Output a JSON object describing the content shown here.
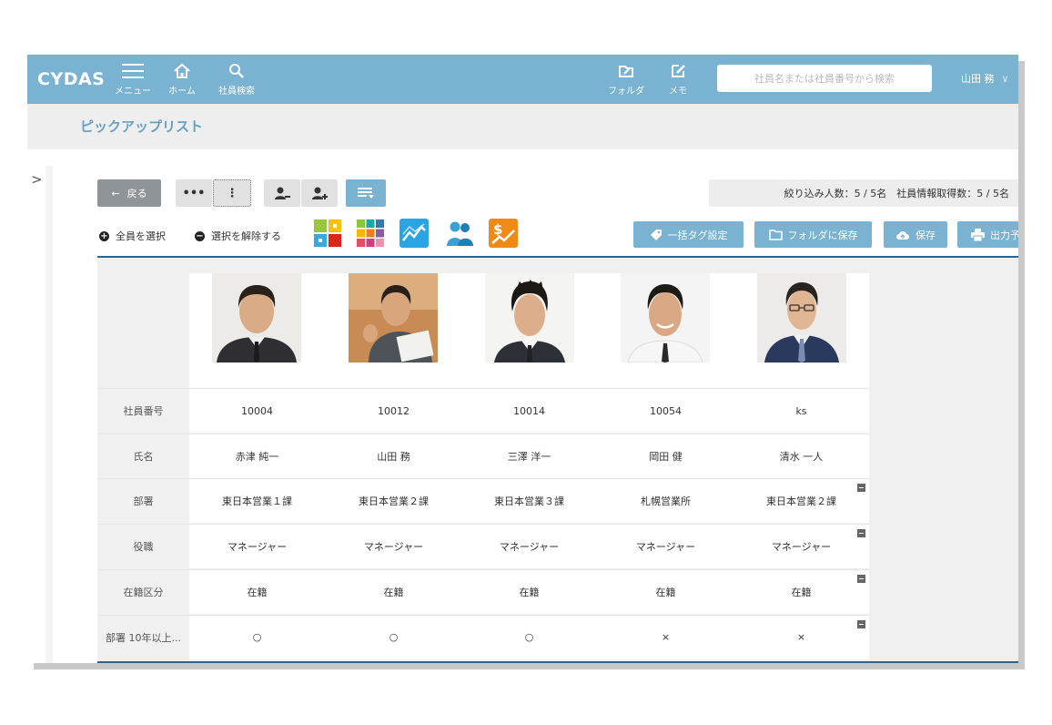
{
  "header": {
    "logo": "CYDAS",
    "nav": [
      {
        "label": "メニュー",
        "icon": "hamburger-icon"
      },
      {
        "label": "ホーム",
        "icon": "home-icon"
      },
      {
        "label": "社員検索",
        "icon": "search-icon"
      }
    ],
    "folder_label": "フォルダ",
    "memo_label": "メモ",
    "search_placeholder": "社員名または社員番号から検索",
    "user_name": "山田 務",
    "user_chevron": "∨"
  },
  "page": {
    "title": "ピックアップリスト"
  },
  "sidebar": {
    "toggle": ">"
  },
  "toolbar": {
    "back_label": "戻る",
    "back_arrow": "←",
    "more_label": "•••",
    "kebab_label": "⋮",
    "count_text": "絞り込み人数：5 / 5名　社員情報取得数：5 / 5名"
  },
  "selection": {
    "select_all": "全員を選択",
    "deselect": "選択を解除する",
    "plus_glyph": "+",
    "minus_glyph": "−"
  },
  "actions": {
    "bulk_tag": "一括タグ設定",
    "save_folder": "フォルダに保存",
    "save": "保存",
    "print_reserve": "出力予約"
  },
  "colors": {
    "accent": "#7ab3d1",
    "divider": "#2f6389",
    "back_button": "#8f9499"
  },
  "table": {
    "rows": [
      {
        "label": "社員番号",
        "collapsible": false,
        "values": [
          "10004",
          "10012",
          "10014",
          "10054",
          "ks"
        ]
      },
      {
        "label": "氏名",
        "collapsible": false,
        "values": [
          "赤津 純一",
          "山田 務",
          "三澤 洋一",
          "岡田 健",
          "清水 一人"
        ]
      },
      {
        "label": "部署",
        "collapsible": true,
        "values": [
          "東日本営業１課",
          "東日本営業２課",
          "東日本営業３課",
          "札幌営業所",
          "東日本営業２課"
        ]
      },
      {
        "label": "役職",
        "collapsible": true,
        "values": [
          "マネージャー",
          "マネージャー",
          "マネージャー",
          "マネージャー",
          "マネージャー"
        ]
      },
      {
        "label": "在籍区分",
        "collapsible": true,
        "values": [
          "在籍",
          "在籍",
          "在籍",
          "在籍",
          "在籍"
        ]
      },
      {
        "label": "部署 10年以上...",
        "collapsible": true,
        "values": [
          "○",
          "○",
          "○",
          "×",
          "×"
        ]
      }
    ]
  }
}
